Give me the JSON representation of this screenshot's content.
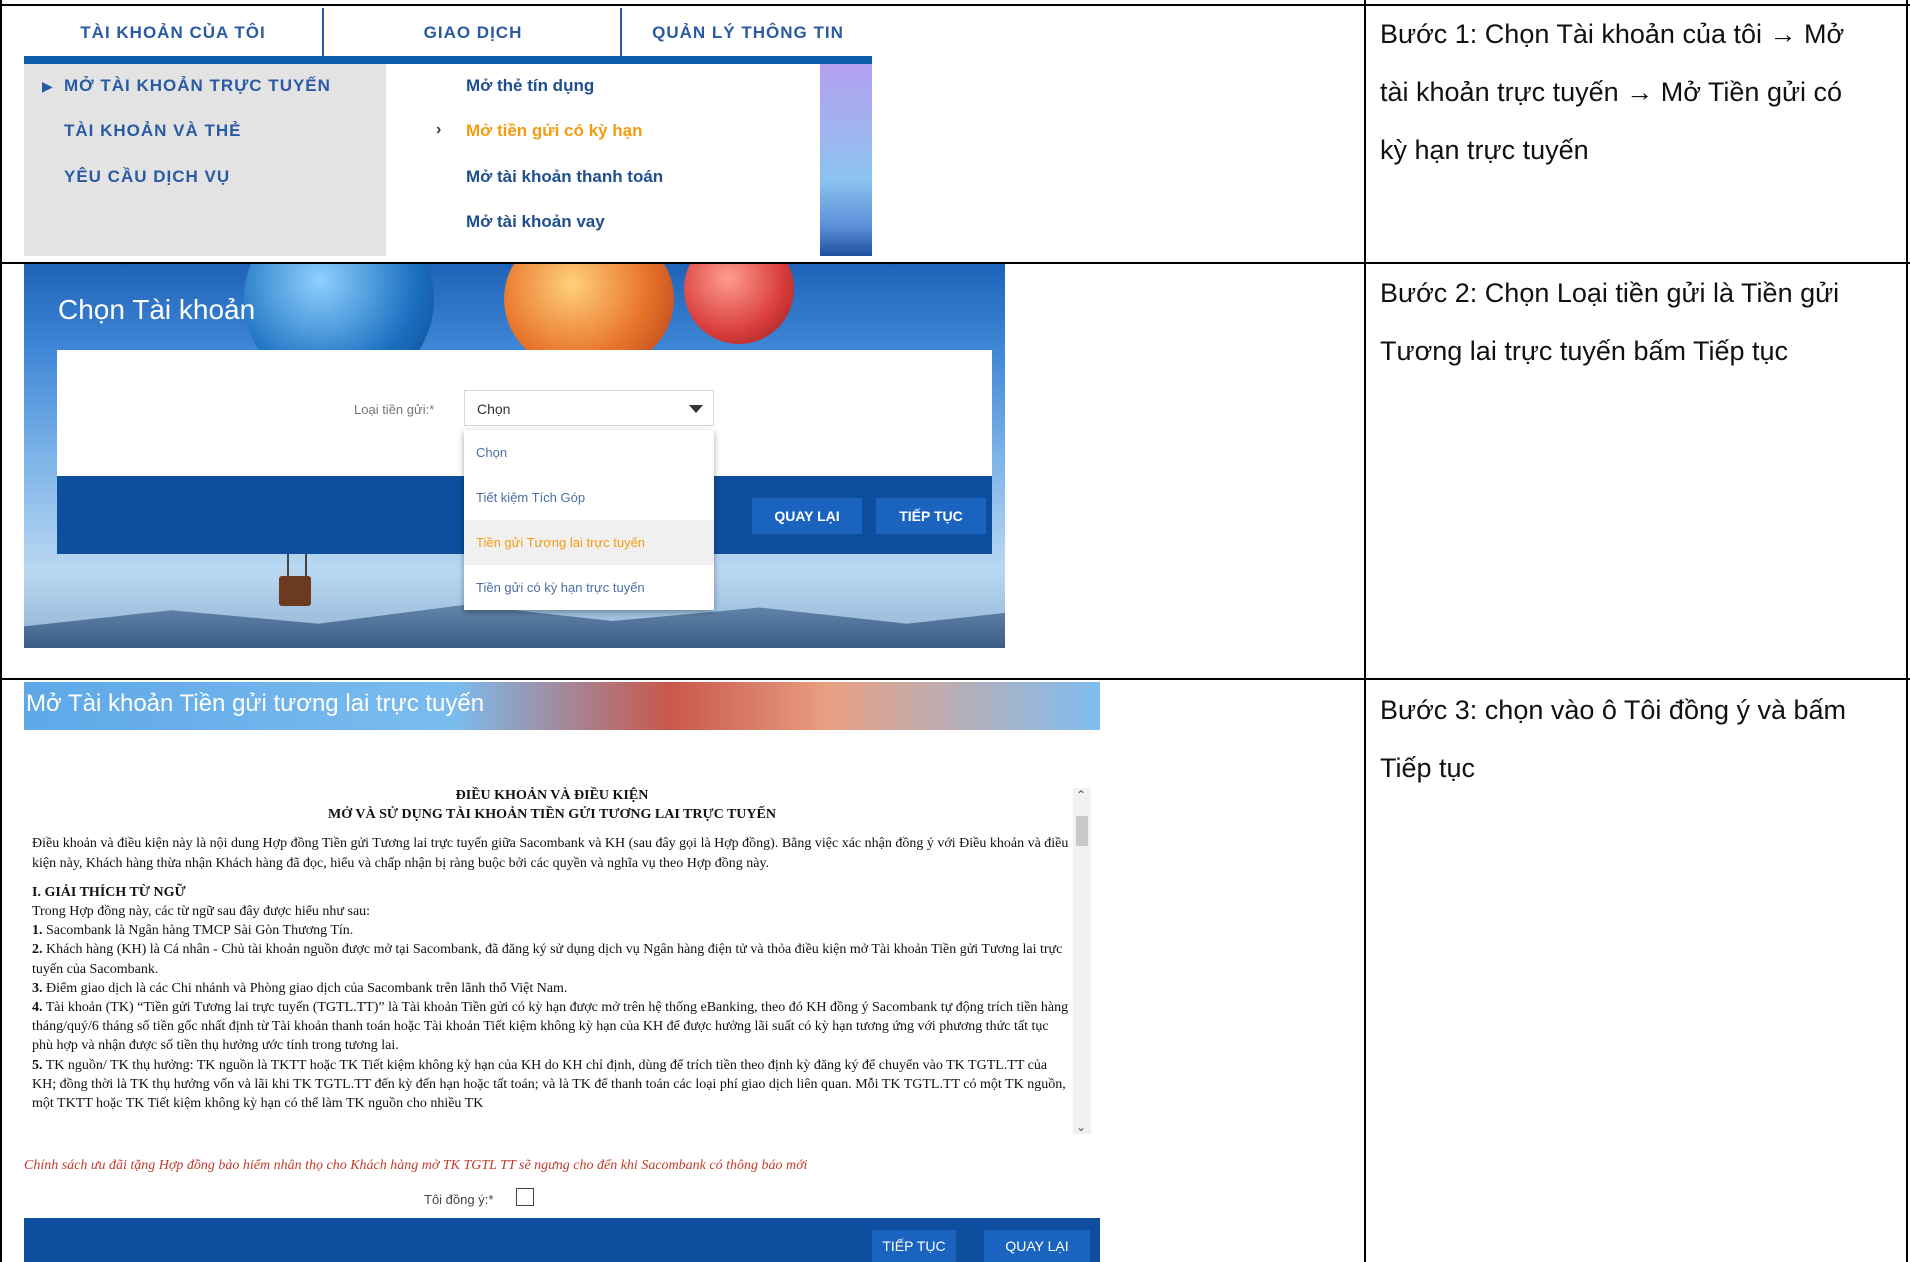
{
  "steps": [
    "Bước 1: Chọn Tài khoản của tôi → Mở tài khoản trực tuyến → Mở Tiền gửi có kỳ hạn trực tuyến",
    "Bước 2: Chọn Loại tiền gửi là Tiền gửi Tương lai trực tuyến  bấm Tiếp tục",
    "Bước 3: chọn vào ô Tôi đồng ý và bấm Tiếp tục"
  ],
  "step1": {
    "line1": "Bước 1: Chọn Tài khoản của tôi → Mở",
    "line2": "tài khoản trực tuyến → Mở Tiền gửi có",
    "line3": "kỳ hạn trực tuyến"
  },
  "step2": {
    "line1": "Bước 2: Chọn Loại tiền gửi là Tiền gửi",
    "line2": "Tương lai trực tuyến  bấm Tiếp tục"
  },
  "step3": {
    "line1": "Bước 3: chọn vào ô Tôi đồng ý và bấm",
    "line2": "Tiếp tục"
  },
  "menu": {
    "tabs": [
      "TÀI KHOẢN CỦA TÔI",
      "GIAO DỊCH",
      "QUẢN LÝ THÔNG TIN"
    ],
    "left_items": [
      "MỞ TÀI KHOẢN TRỰC TUYẾN",
      "TÀI KHOẢN VÀ THẺ",
      "YÊU CẦU DỊCH VỤ"
    ],
    "sub_items": [
      "Mở thẻ tín dụng",
      "Mở tiền gửi có kỳ hạn",
      "Mở tài khoản thanh toán",
      "Mở tài khoản vay"
    ]
  },
  "choose_account": {
    "title": "Chọn Tài khoản",
    "label": "Loại tiền gửi:*",
    "selected": "Chọn",
    "options": [
      "Chọn",
      "Tiết kiệm Tích Góp",
      "Tiền gửi Tương lai trực tuyến",
      "Tiền gửi có kỳ hạn trực tuyến"
    ],
    "back_button": "QUAY LẠI",
    "next_button": "TIẾP TỤC"
  },
  "terms": {
    "page_title": "Mở Tài khoản Tiền gửi tương lai trực tuyến",
    "heading1": "ĐIỀU KHOẢN VÀ ĐIỀU KIỆN",
    "heading2": "MỞ VÀ SỬ DỤNG TÀI KHOẢN TIỀN GỬI TƯƠNG LAI TRỰC TUYẾN",
    "intro": "Điều khoản và điều kiện này là nội dung Hợp đồng Tiền gửi Tương lai trực tuyến giữa Sacombank và KH (sau đây gọi là Hợp đồng). Bằng việc xác nhận đồng ý với Điều khoản và điều kiện này, Khách hàng thừa nhận Khách hàng đã đọc, hiểu và chấp nhận bị ràng buộc bởi các quyền và nghĩa vụ theo Hợp đồng này.",
    "section1": "I. GIẢI THÍCH TỪ NGỮ",
    "section1_intro": "Trong Hợp đồng này, các từ ngữ sau đây được hiểu như sau:",
    "items": [
      {
        "num": "1.",
        "text": "Sacombank là Ngân hàng TMCP Sài Gòn Thương Tín."
      },
      {
        "num": "2.",
        "text": "Khách hàng (KH) là Cá nhân - Chủ tài khoản nguồn được mở tại Sacombank, đã đăng ký sử dụng dịch vụ Ngân hàng điện tử và thỏa điều kiện mở Tài khoản Tiền gửi Tương lai trực tuyến của Sacombank."
      },
      {
        "num": "3.",
        "text": "Điểm giao dịch là các Chi nhánh và Phòng giao dịch của Sacombank trên lãnh thổ Việt Nam."
      },
      {
        "num": "4.",
        "text": "Tài khoản (TK) “Tiền gửi Tương lai trực tuyến (TGTL.TT)” là Tài khoản Tiền gửi có kỳ hạn được mở trên hệ thống eBanking, theo đó KH đồng ý Sacombank tự động trích tiền hàng tháng/quý/6 tháng số tiền gốc nhất định từ Tài khoản thanh toán hoặc Tài khoản Tiết kiệm không kỳ hạn của KH để được hưởng lãi suất có kỳ hạn tương ứng với phương thức tất tục phù hợp và nhận được số tiền thụ hưởng ước tính trong tương lai."
      },
      {
        "num": "5.",
        "text": "TK nguồn/ TK thụ hưởng: TK nguồn là TKTT hoặc TK Tiết kiệm không kỳ hạn của KH do KH chỉ định, dùng để trích tiền theo định kỳ đăng ký để chuyển vào TK TGTL.TT của KH; đồng thời là TK thụ hưởng vốn và lãi khi TK TGTL.TT đến kỳ đến hạn hoặc tất toán; và là TK để thanh toán các loại phí giao dịch liên quan. Mỗi TK TGTL.TT có một TK nguồn, một TKTT hoặc TK Tiết kiệm không kỳ hạn có thể làm TK nguồn cho nhiều TK"
      }
    ],
    "note": "Chính sách ưu đãi tặng Hợp đồng bảo hiểm nhân thọ cho Khách hàng mở TK TGTL TT sẽ ngưng cho đến khi Sacombank có thông báo mới",
    "agree_label": "Tôi đồng ý:*",
    "next_button": "TIẾP TỤC",
    "back_button": "QUAY LẠI"
  }
}
